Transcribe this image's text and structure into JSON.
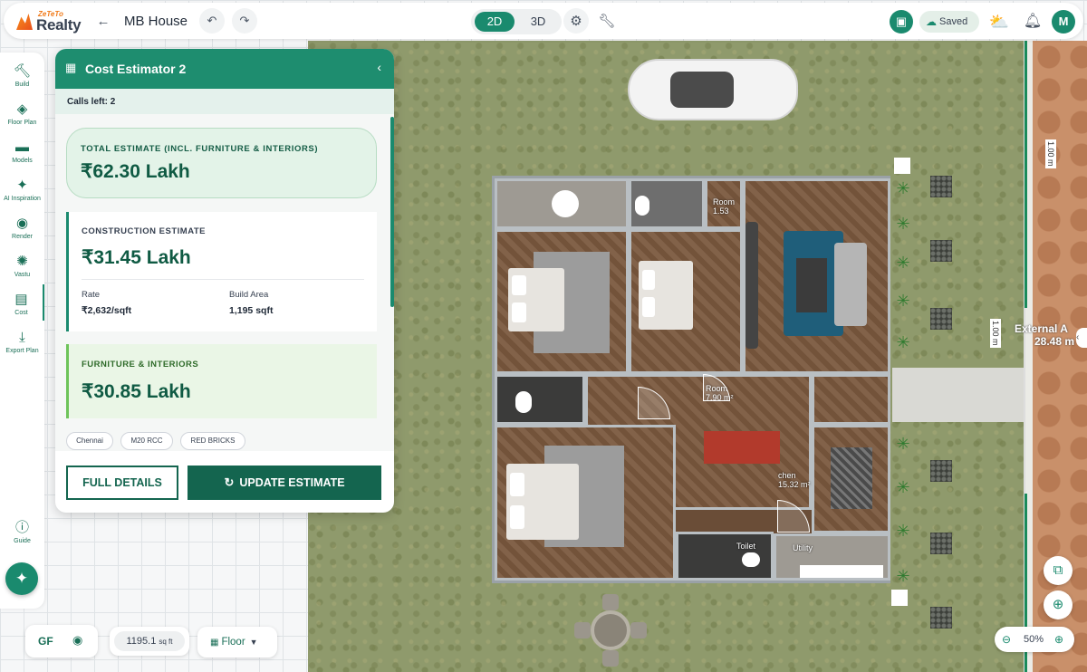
{
  "app": {
    "brand_small": "ZeTeTo",
    "brand": "Realty",
    "project_title": "MB House"
  },
  "toolbar": {
    "back_icon": "arrow-left-icon",
    "undo_icon": "undo-icon",
    "redo_icon": "redo-icon",
    "view_modes": [
      "2D",
      "3D"
    ],
    "active_view": "2D",
    "settings_icon": "gear-icon",
    "tools_icon": "wrench-icon",
    "save_status": "Saved",
    "user_initial": "M"
  },
  "sidebar": {
    "items": [
      {
        "label": "Build",
        "icon": "hammer-icon"
      },
      {
        "label": "Floor Plan",
        "icon": "layers-icon"
      },
      {
        "label": "Models",
        "icon": "sofa-icon"
      },
      {
        "label": "AI Inspiration",
        "icon": "sparkle-icon"
      },
      {
        "label": "Render",
        "icon": "camera-icon"
      },
      {
        "label": "Vastu",
        "icon": "vastu-icon"
      },
      {
        "label": "Cost",
        "icon": "cost-icon"
      },
      {
        "label": "Export Plan",
        "icon": "download-icon"
      }
    ],
    "active": "Cost",
    "guide_label": "Guide"
  },
  "estimator": {
    "title": "Cost Estimator 2",
    "calls_left": "Calls left: 2",
    "total_label": "TOTAL ESTIMATE (INCL. FURNITURE & INTERIORS)",
    "total_value": "₹62.30 Lakh",
    "construction_label": "CONSTRUCTION ESTIMATE",
    "construction_value": "₹31.45 Lakh",
    "rate_label": "Rate",
    "rate_value": "₹2,632/sqft",
    "build_area_label": "Build Area",
    "build_area_value": "1,195 sqft",
    "furniture_label": "FURNITURE & INTERIORS",
    "furniture_value": "₹30.85 Lakh",
    "tags": [
      "Chennai",
      "M20 RCC",
      "RED BRICKS"
    ],
    "full_details_label": "FULL DETAILS",
    "update_label": "UPDATE ESTIMATE"
  },
  "plan_labels": {
    "room_a": "Room",
    "room_a_area": "1.53",
    "room_b": "Room",
    "room_b_area": "7.90 m²",
    "kitchen": "chen",
    "kitchen_area": "15.32 m²",
    "toilet": "Toilet",
    "utility": "Utility",
    "external": "External A",
    "external_area": "28.48 m",
    "dim_1": "1.00 m",
    "dim_2": "1.00 m"
  },
  "bottom": {
    "floor_code": "GF",
    "area_value": "1195.1",
    "area_unit": "sq ft",
    "floor_dropdown": "Floor",
    "zoom": "50%"
  },
  "colors": {
    "accent": "#1a8a6e",
    "accent_dark": "#14654f",
    "total_card_bg": "#e3f3e8",
    "furniture_card_bg": "#eaf6e6"
  }
}
